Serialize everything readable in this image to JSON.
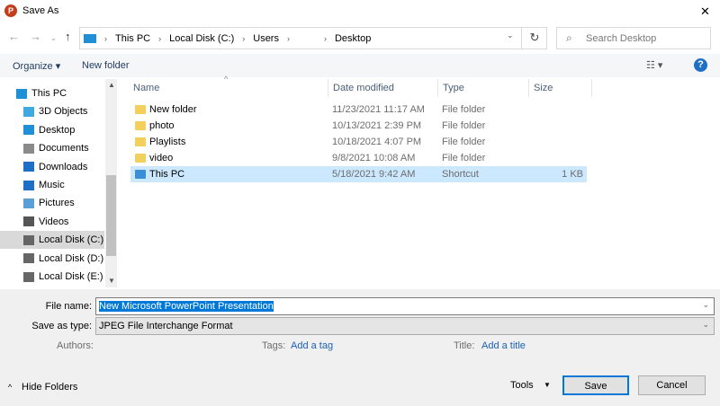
{
  "window": {
    "title": "Save As",
    "close": "✕"
  },
  "nav": {
    "breadcrumb": [
      "This PC",
      "Local Disk (C:)",
      "Users",
      "",
      "Desktop"
    ],
    "search_placeholder": "Search Desktop"
  },
  "toolbar": {
    "organize": "Organize ▾",
    "new_folder": "New folder"
  },
  "sidebar": {
    "items": [
      {
        "label": "This PC",
        "icon": "pc-icon",
        "color": "#1f8fd6"
      },
      {
        "label": "3D Objects",
        "icon": "cube-icon",
        "color": "#3fa9e0"
      },
      {
        "label": "Desktop",
        "icon": "desktop-icon",
        "color": "#1f8fd6"
      },
      {
        "label": "Documents",
        "icon": "document-icon",
        "color": "#8a8a8a"
      },
      {
        "label": "Downloads",
        "icon": "download-icon",
        "color": "#1f6fc6"
      },
      {
        "label": "Music",
        "icon": "music-icon",
        "color": "#1f6fc6"
      },
      {
        "label": "Pictures",
        "icon": "picture-icon",
        "color": "#5aa0d8"
      },
      {
        "label": "Videos",
        "icon": "video-icon",
        "color": "#555555"
      },
      {
        "label": "Local Disk (C:)",
        "icon": "drive-icon",
        "color": "#666666",
        "selected": true
      },
      {
        "label": "Local Disk (D:)",
        "icon": "drive-icon",
        "color": "#666666"
      },
      {
        "label": "Local Disk (E:)",
        "icon": "drive-icon",
        "color": "#666666"
      }
    ]
  },
  "columns": [
    "Name",
    "Date modified",
    "Type",
    "Size"
  ],
  "files": [
    {
      "name": "New folder",
      "date": "11/23/2021 11:17 AM",
      "type": "File folder",
      "size": ""
    },
    {
      "name": "photo",
      "date": "10/13/2021 2:39 PM",
      "type": "File folder",
      "size": ""
    },
    {
      "name": "Playlists",
      "date": "10/18/2021 4:07 PM",
      "type": "File folder",
      "size": ""
    },
    {
      "name": "video",
      "date": "9/8/2021 10:08 AM",
      "type": "File folder",
      "size": ""
    },
    {
      "name": "This PC",
      "date": "5/18/2021 9:42 AM",
      "type": "Shortcut",
      "size": "1 KB"
    }
  ],
  "form": {
    "file_name_label": "File name:",
    "file_name": "New Microsoft PowerPoint Presentation",
    "type_label": "Save as type:",
    "type": "JPEG File Interchange Format",
    "authors_label": "Authors:",
    "tags_label": "Tags:",
    "tags_link": "Add a tag",
    "title_label": "Title:",
    "title_link": "Add a title"
  },
  "footer": {
    "hide_folders": "Hide Folders",
    "tools": "Tools",
    "save": "Save",
    "cancel": "Cancel"
  }
}
